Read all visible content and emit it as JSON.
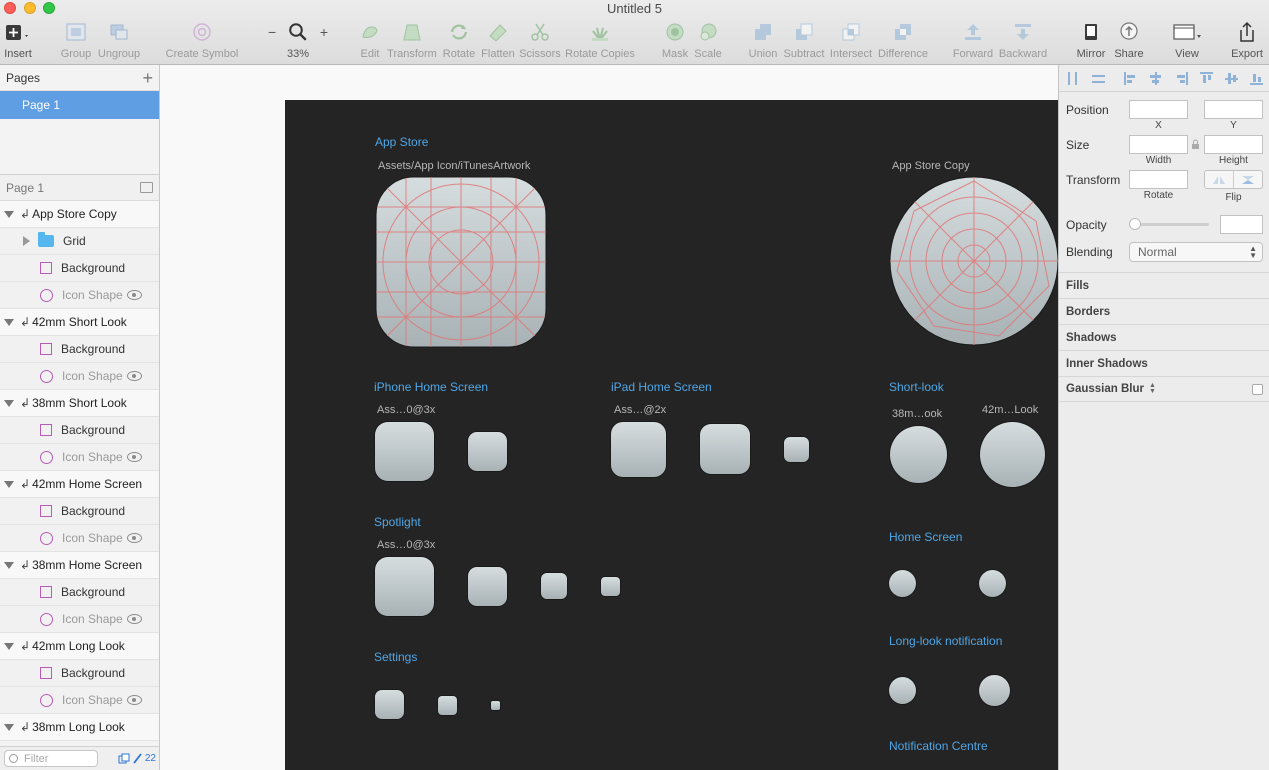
{
  "window": {
    "title": "Untitled 5"
  },
  "toolbar": {
    "insert": "Insert",
    "group": "Group",
    "ungroup": "Ungroup",
    "create_symbol": "Create Symbol",
    "zoom_minus": "−",
    "zoom_plus": "+",
    "zoom_level": "33%",
    "edit": "Edit",
    "transform": "Transform",
    "rotate": "Rotate",
    "flatten": "Flatten",
    "scissors": "Scissors",
    "rotate_copies": "Rotate Copies",
    "mask": "Mask",
    "scale": "Scale",
    "union": "Union",
    "subtract": "Subtract",
    "intersect": "Intersect",
    "difference": "Difference",
    "forward": "Forward",
    "backward": "Backward",
    "mirror": "Mirror",
    "share": "Share",
    "view": "View",
    "export": "Export"
  },
  "sidebar": {
    "pages_title": "Pages",
    "pages_add": "+",
    "pages": [
      "Page 1"
    ],
    "layers_page": "Page 1",
    "layers": [
      {
        "kind": "group",
        "name": "App Store Copy"
      },
      {
        "kind": "folder",
        "name": "Grid"
      },
      {
        "kind": "rect",
        "name": "Background"
      },
      {
        "kind": "shape",
        "name": "Icon Shape"
      },
      {
        "kind": "group",
        "name": "42mm Short Look"
      },
      {
        "kind": "rect",
        "name": "Background"
      },
      {
        "kind": "shape",
        "name": "Icon Shape"
      },
      {
        "kind": "group",
        "name": "38mm Short Look"
      },
      {
        "kind": "rect",
        "name": "Background"
      },
      {
        "kind": "shape",
        "name": "Icon Shape"
      },
      {
        "kind": "group",
        "name": "42mm Home Screen"
      },
      {
        "kind": "rect",
        "name": "Background"
      },
      {
        "kind": "shape",
        "name": "Icon Shape"
      },
      {
        "kind": "group",
        "name": "38mm Home Screen"
      },
      {
        "kind": "rect",
        "name": "Background"
      },
      {
        "kind": "shape",
        "name": "Icon Shape"
      },
      {
        "kind": "group",
        "name": "42mm Long Look"
      },
      {
        "kind": "rect",
        "name": "Background"
      },
      {
        "kind": "shape",
        "name": "Icon Shape"
      },
      {
        "kind": "group",
        "name": "38mm Long Look"
      }
    ],
    "filter_placeholder": "Filter",
    "layer_count": "22"
  },
  "artboard": {
    "app_store": "App Store",
    "app_store_sub": "Assets/App Icon/iTunesArtwork",
    "app_store_copy": "App Store Copy",
    "iphone": "iPhone Home Screen",
    "iphone_sub": "Ass…0@3x",
    "ipad": "iPad Home Screen",
    "ipad_sub": "Ass…@2x",
    "short_look": "Short-look",
    "short_look_sub1": "38m…ook",
    "short_look_sub2": "42m…Look",
    "spotlight": "Spotlight",
    "spotlight_sub": "Ass…0@3x",
    "home_screen": "Home Screen",
    "settings": "Settings",
    "long_look": "Long-look notification",
    "notification": "Notification Centre"
  },
  "inspector": {
    "position": "Position",
    "x": "X",
    "y": "Y",
    "size": "Size",
    "width": "Width",
    "height": "Height",
    "transform": "Transform",
    "rotate": "Rotate",
    "flip": "Flip",
    "opacity": "Opacity",
    "blending": "Blending",
    "blending_value": "Normal",
    "fills": "Fills",
    "borders": "Borders",
    "shadows": "Shadows",
    "inner_shadows": "Inner Shadows",
    "gaussian_blur": "Gaussian Blur"
  }
}
